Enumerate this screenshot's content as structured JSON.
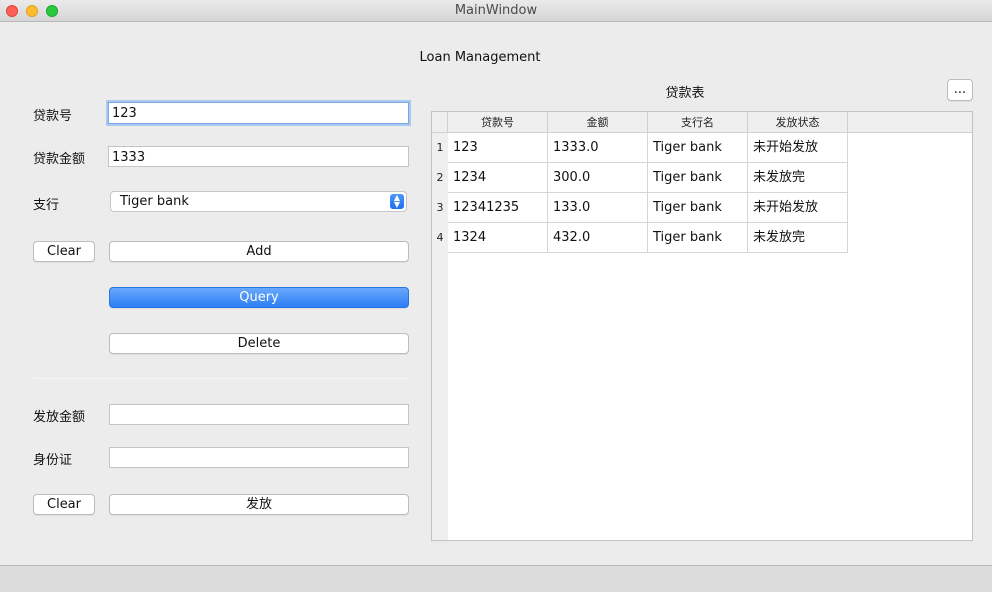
{
  "window": {
    "title": "MainWindow"
  },
  "header": {
    "title": "Loan Management"
  },
  "loan_form": {
    "loan_no_label": "贷款号",
    "loan_no_value": "123",
    "amount_label": "贷款金额",
    "amount_value": "1333",
    "branch_label": "支行",
    "branch_selected": "Tiger bank",
    "clear_label": "Clear",
    "add_label": "Add",
    "query_label": "Query",
    "delete_label": "Delete"
  },
  "disburse_form": {
    "amount_label": "发放金额",
    "amount_value": "",
    "id_label": "身份证",
    "id_value": "",
    "clear_label": "Clear",
    "disburse_label": "发放"
  },
  "table_panel": {
    "title": "贷款表",
    "more_label": "...",
    "columns": [
      "贷款号",
      "金额",
      "支行名",
      "发放状态"
    ],
    "rows": [
      {
        "num": "1",
        "cells": [
          "123",
          "1333.0",
          "Tiger bank",
          "未开始发放"
        ]
      },
      {
        "num": "2",
        "cells": [
          "1234",
          "300.0",
          "Tiger bank",
          "未发放完"
        ]
      },
      {
        "num": "3",
        "cells": [
          "12341235",
          "133.0",
          "Tiger bank",
          "未开始发放"
        ]
      },
      {
        "num": "4",
        "cells": [
          "1324",
          "432.0",
          "Tiger bank",
          "未发放完"
        ]
      }
    ]
  },
  "colors": {
    "accent": "#2a7ef5",
    "focus_ring": "#a9c8f2",
    "window_bg": "#ececec"
  }
}
